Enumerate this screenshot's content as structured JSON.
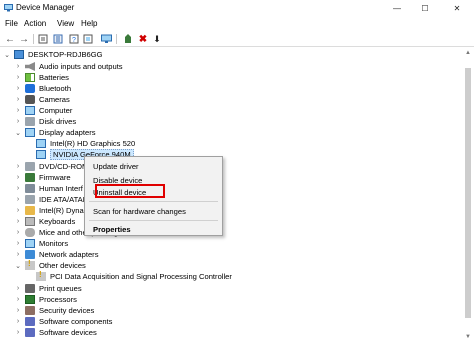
{
  "window": {
    "title": "Device Manager",
    "minimize_icon": "—",
    "maximize_icon": "☐",
    "close_icon": "✕"
  },
  "menu": [
    "File",
    "Action",
    "View",
    "Help"
  ],
  "toolbar": {
    "back_icon": "←",
    "forward_icon": "→",
    "uninstall_icon": "✖",
    "update_icon": "⬇"
  },
  "tree": {
    "root": "DESKTOP-RDJB6GG",
    "categories": [
      {
        "label": "Audio inputs and outputs"
      },
      {
        "label": "Batteries"
      },
      {
        "label": "Bluetooth"
      },
      {
        "label": "Cameras"
      },
      {
        "label": "Computer"
      },
      {
        "label": "Disk drives"
      },
      {
        "label": "Display adapters"
      },
      {
        "label": "Intel(R) HD Graphics 520"
      },
      {
        "label": "NVIDIA GeForce 940M"
      },
      {
        "label": "DVD/CD-ROM"
      },
      {
        "label": "Firmware"
      },
      {
        "label": "Human Interf"
      },
      {
        "label": "IDE ATA/ATAP"
      },
      {
        "label": "Intel(R) Dyna"
      },
      {
        "label": "Keyboards"
      },
      {
        "label": "Mice and other pointing devices"
      },
      {
        "label": "Monitors"
      },
      {
        "label": "Network adapters"
      },
      {
        "label": "Other devices"
      },
      {
        "label": "PCI Data Acquisition and Signal Processing Controller"
      },
      {
        "label": "Print queues"
      },
      {
        "label": "Processors"
      },
      {
        "label": "Security devices"
      },
      {
        "label": "Software components"
      },
      {
        "label": "Software devices"
      }
    ]
  },
  "context_menu": {
    "items": [
      "Update driver",
      "Disable device",
      "Uninstall device",
      "Scan for hardware changes",
      "Properties"
    ]
  }
}
